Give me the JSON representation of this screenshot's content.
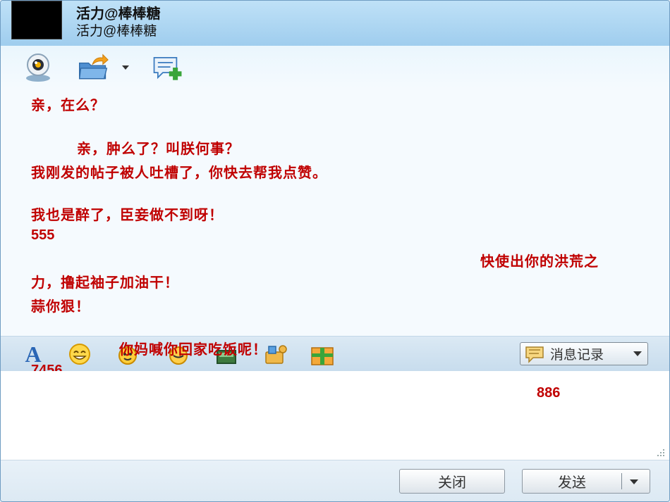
{
  "contact": {
    "name": "活力@棒棒糖",
    "signature": "活力@棒棒糖"
  },
  "toolbar": {
    "icons": [
      "webcam-icon",
      "send-file-icon",
      "add-chat-icon"
    ]
  },
  "chat": {
    "messages": [
      "亲，在么？",
      "亲，肿么了？叫朕何事？",
      "我刚发的帖子被人吐槽了，你快去帮我点赞。",
      "我也是醉了，臣妾做不到呀！",
      "555",
      "快使出你的洪荒之",
      "力，撸起袖子加油干！",
      "蒜你狠！",
      "你妈喊你回家吃饭呢！",
      "7456",
      "886"
    ]
  },
  "emoji_bar": {
    "font_glyph": "A",
    "history_label": "消息记录"
  },
  "footer": {
    "close_label": "关闭",
    "send_label": "发送"
  }
}
